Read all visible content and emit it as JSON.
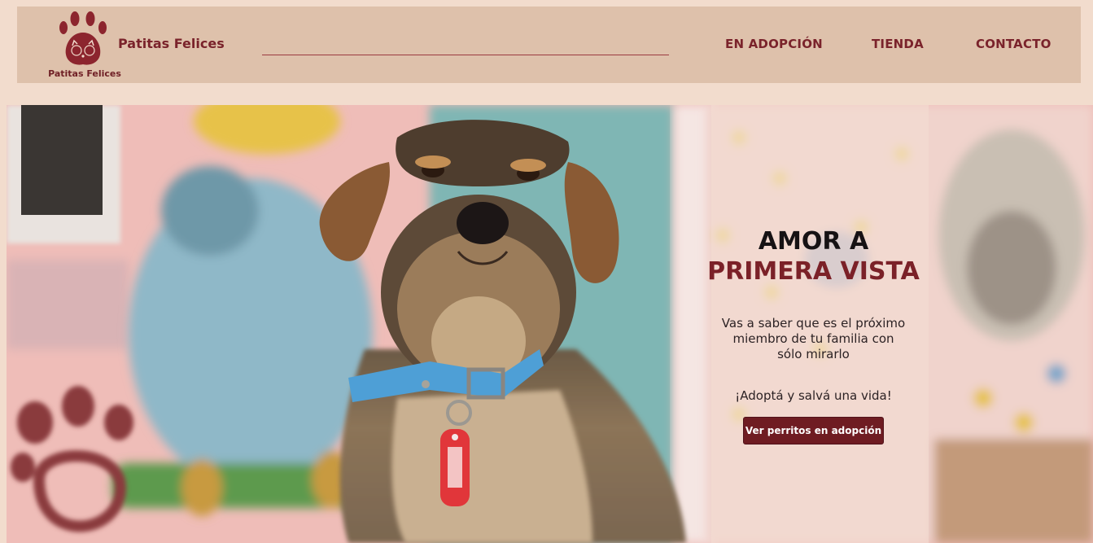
{
  "header": {
    "logo_icon": "paw-with-cat-and-dog-icon",
    "logo_caption": "Patitas Felices",
    "brand_name": "Patitas Felices",
    "search": {
      "placeholder": "",
      "value": ""
    },
    "nav": [
      {
        "label": "EN ADOPCIÓN"
      },
      {
        "label": "TIENDA"
      },
      {
        "label": "CONTACTO"
      }
    ]
  },
  "hero": {
    "photo": "dog-with-blue-collar-in-front-of-mural",
    "headline_line1": "AMOR A",
    "headline_line2": "PRIMERA VISTA",
    "subtext": "Vas a saber que es el próximo miembro de tu familia con sólo mirarlo",
    "cta_text": "¡Adoptá y salvá una vida!",
    "cta_button": "Ver perritos en adopción"
  },
  "colors": {
    "page_bg": "#f2dccd",
    "header_bg": "#dec1ab",
    "brand": "#7a232b",
    "button_bg": "#6f1c22"
  }
}
